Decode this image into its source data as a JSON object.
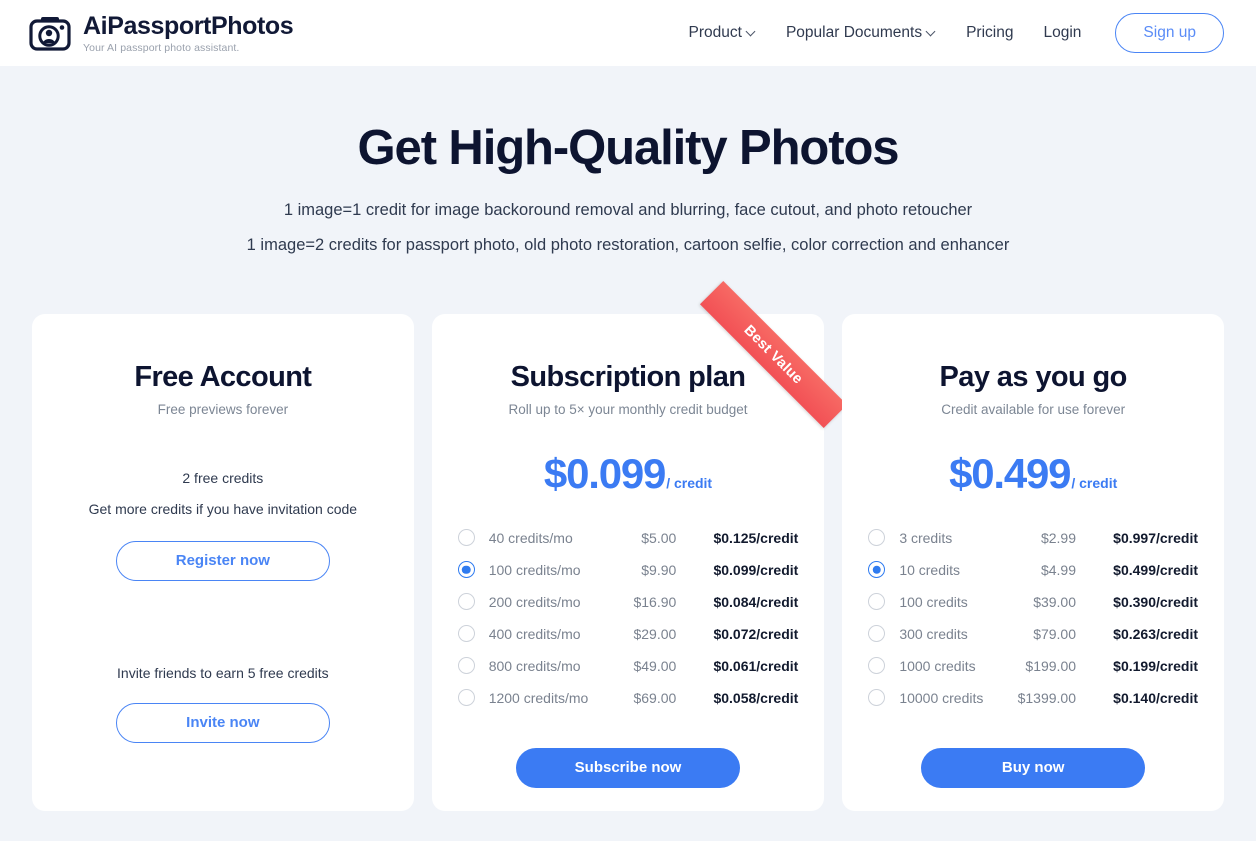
{
  "header": {
    "brand_name": "AiPassportPhotos",
    "brand_tagline": "Your AI passport photo assistant.",
    "logo_icon": "camera-portrait-icon",
    "nav": [
      {
        "label": "Product",
        "has_caret": true
      },
      {
        "label": "Popular Documents",
        "has_caret": true
      },
      {
        "label": "Pricing",
        "has_caret": false
      },
      {
        "label": "Login",
        "has_caret": false
      }
    ],
    "signup_label": "Sign up"
  },
  "hero": {
    "title": "Get High-Quality Photos",
    "line1": "1 image=1 credit for image backoround removal and blurring, face cutout, and photo retoucher",
    "line2": "1 image=2 credits for passport photo, old photo restoration, cartoon selfie, color correction and enhancer"
  },
  "colors": {
    "page_bg": "#f1f4f9",
    "card_bg": "#ffffff",
    "accent_blue": "#3b7bf3",
    "ribbon_red": "#f25055",
    "title_navy": "#0d1430",
    "muted_gray": "#7a828f"
  },
  "cards": {
    "free": {
      "title": "Free Account",
      "subtitle": "Free previews forever",
      "credits_line": "2 free credits",
      "hint_line": "Get more credits if you have invitation code",
      "register_label": "Register now",
      "invite_line": "Invite friends to earn 5 free credits",
      "invite_label": "Invite now"
    },
    "subscription": {
      "ribbon": "Best Value",
      "title": "Subscription plan",
      "subtitle": "Roll up to 5× your monthly credit budget",
      "price_amount": "$0.099",
      "price_unit": "/ credit",
      "cta_label": "Subscribe now",
      "options": [
        {
          "label": "40 credits/mo",
          "price": "$5.00",
          "unit_price": "$0.125/credit",
          "selected": false
        },
        {
          "label": "100 credits/mo",
          "price": "$9.90",
          "unit_price": "$0.099/credit",
          "selected": true
        },
        {
          "label": "200 credits/mo",
          "price": "$16.90",
          "unit_price": "$0.084/credit",
          "selected": false
        },
        {
          "label": "400 credits/mo",
          "price": "$29.00",
          "unit_price": "$0.072/credit",
          "selected": false
        },
        {
          "label": "800 credits/mo",
          "price": "$49.00",
          "unit_price": "$0.061/credit",
          "selected": false
        },
        {
          "label": "1200 credits/mo",
          "price": "$69.00",
          "unit_price": "$0.058/credit",
          "selected": false
        }
      ]
    },
    "payg": {
      "title": "Pay as you go",
      "subtitle": "Credit available for use forever",
      "price_amount": "$0.499",
      "price_unit": "/ credit",
      "cta_label": "Buy now",
      "options": [
        {
          "label": "3 credits",
          "price": "$2.99",
          "unit_price": "$0.997/credit",
          "selected": false
        },
        {
          "label": "10 credits",
          "price": "$4.99",
          "unit_price": "$0.499/credit",
          "selected": true
        },
        {
          "label": "100 credits",
          "price": "$39.00",
          "unit_price": "$0.390/credit",
          "selected": false
        },
        {
          "label": "300 credits",
          "price": "$79.00",
          "unit_price": "$0.263/credit",
          "selected": false
        },
        {
          "label": "1000 credits",
          "price": "$199.00",
          "unit_price": "$0.199/credit",
          "selected": false
        },
        {
          "label": "10000 credits",
          "price": "$1399.00",
          "unit_price": "$0.140/credit",
          "selected": false
        }
      ]
    }
  }
}
